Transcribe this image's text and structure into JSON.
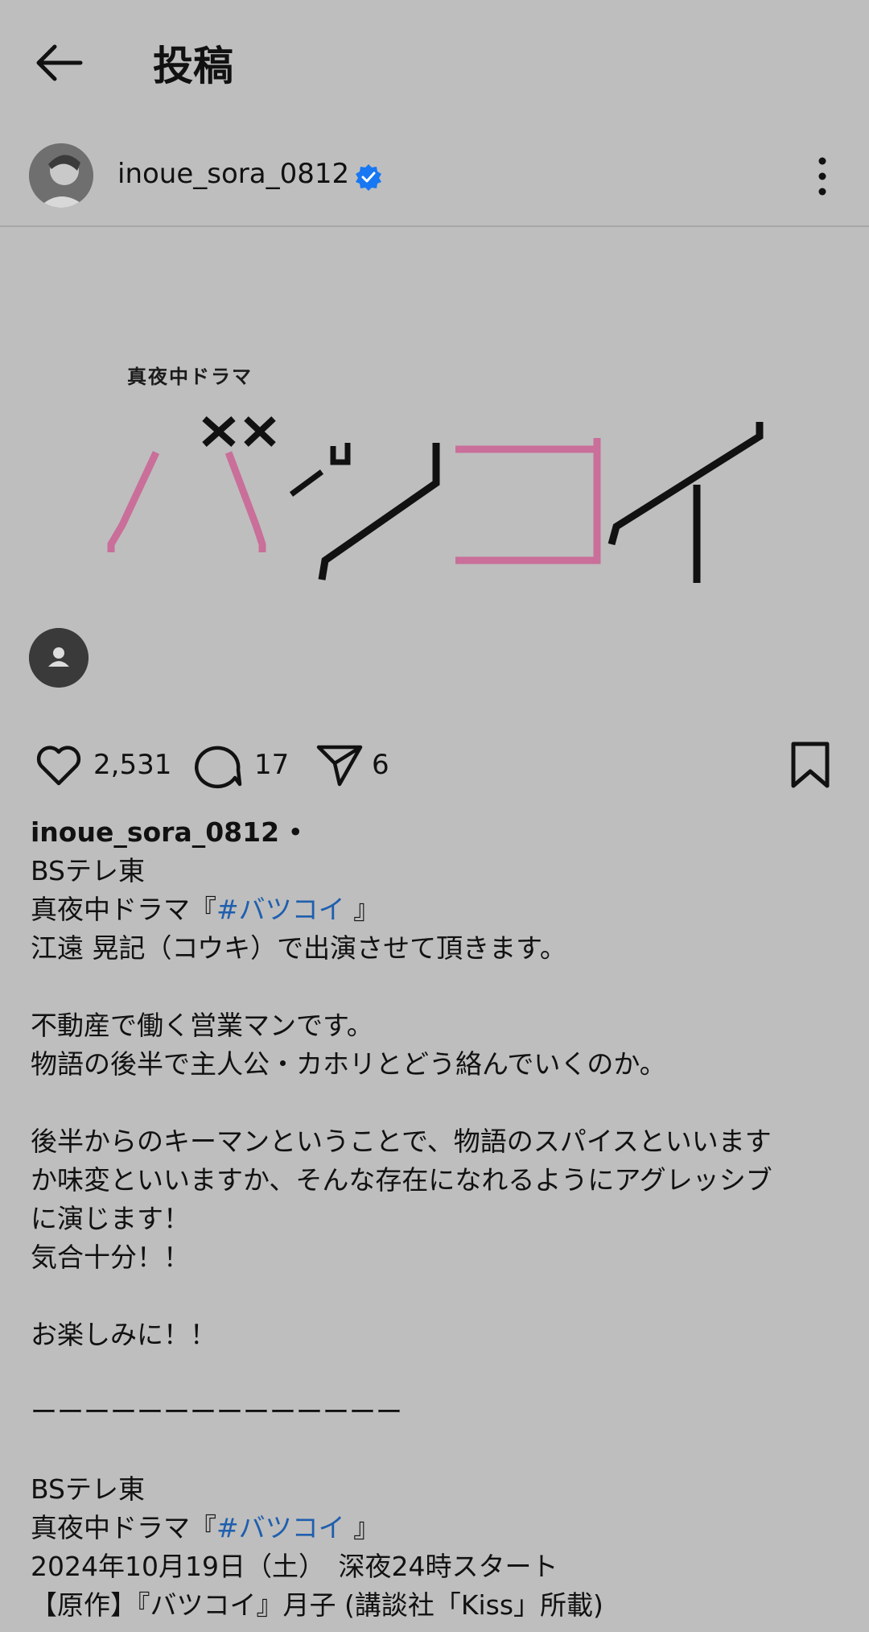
{
  "header": {
    "title": "投稿"
  },
  "post": {
    "username": "inoue_sora_0812",
    "image": {
      "subtitle": "真夜中ドラマ",
      "logo_text": "バツコイ",
      "colors": {
        "pink": "#c96f99",
        "black": "#111111"
      }
    },
    "likes": "2,531",
    "comments": "17",
    "shares": "6"
  },
  "caption": {
    "user": "inoue_sora_0812",
    "sep": " •",
    "l1": "BSテレ東",
    "l2_pre": "真夜中ドラマ『",
    "hashtag": "#バツコイ",
    "l2_post": " 』",
    "l3": "江遠 晃記（コウキ）で出演させて頂きます。",
    "l5": "不動産で働く営業マンです。",
    "l6": "物語の後半で主人公・カホリとどう絡んでいくのか。",
    "l8": "後半からのキーマンということで、物語のスパイスといいます",
    "l9": "か味変といいますか、そんな存在になれるようにアグレッシブ",
    "l10": "に演じます！",
    "l11": "気合十分！！",
    "l13": "お楽しみに！！",
    "l15": "ーーーーーーーーーーーーーー",
    "l17": "BSテレ東",
    "l18_pre": "真夜中ドラマ『",
    "l18_post": " 』",
    "l19": "2024年10月19日（土）　深夜24時スタート",
    "l20": "【原作】『バツコイ』月子 (講談社「Kiss」所載)"
  },
  "icons": {
    "back": "arrow-left-icon",
    "verified": "verified-badge-icon",
    "more": "more-vertical-icon",
    "like": "heart-icon",
    "comment": "comment-icon",
    "share": "send-icon",
    "save": "bookmark-icon",
    "tag": "person-icon"
  },
  "colors": {
    "background": "#bebebe",
    "link": "#1f5fae",
    "verified": "#1877f2"
  }
}
